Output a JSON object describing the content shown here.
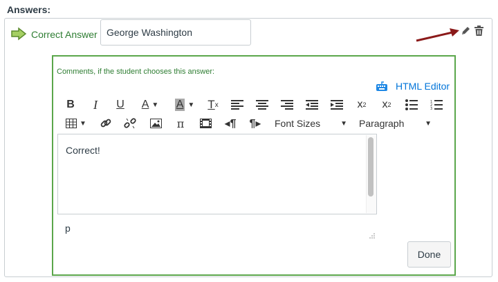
{
  "section": {
    "title": "Answers:"
  },
  "answer": {
    "label": "Correct Answer",
    "value": "George Washington"
  },
  "comments": {
    "label": "Comments, if the student chooses this answer:",
    "html_editor_link": "HTML Editor",
    "body_text": "Correct!",
    "path": "p",
    "done_label": "Done"
  },
  "toolbar": {
    "font_sizes": "Font Sizes",
    "paragraph": "Paragraph",
    "row1": [
      "bold",
      "italic",
      "underline",
      "text-color",
      "background-color",
      "clear-formatting",
      "align-left",
      "align-center",
      "align-right",
      "outdent",
      "indent",
      "superscript",
      "subscript",
      "bullet-list",
      "numbered-list"
    ],
    "row2": [
      "table",
      "link",
      "unlink",
      "image",
      "equation",
      "media",
      "ltr",
      "rtl"
    ]
  },
  "colors": {
    "correct_green": "#2e7d32",
    "box_border": "#5aa64a",
    "link_blue": "#0074d9",
    "annotation_arrow": "#8b1a1a"
  }
}
